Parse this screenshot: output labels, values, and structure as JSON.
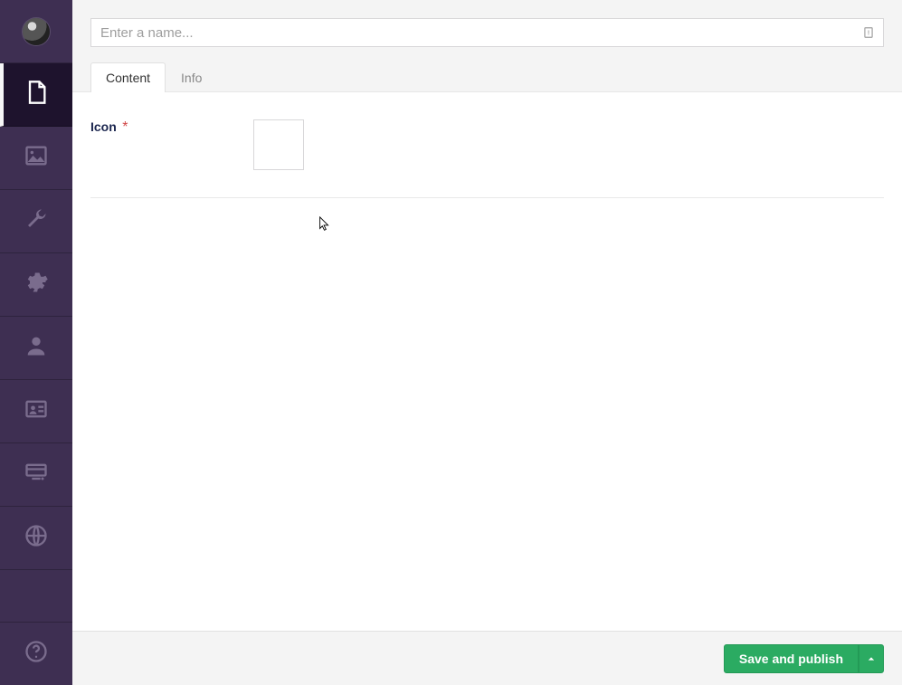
{
  "header": {
    "name_value": "",
    "name_placeholder": "Enter a name..."
  },
  "tabs": {
    "content": "Content",
    "info": "Info"
  },
  "fields": {
    "icon": {
      "label": "Icon",
      "required_marker": "*"
    }
  },
  "footer": {
    "save_publish_label": "Save and publish"
  },
  "sidebar": {
    "items": [
      {
        "name": "avatar"
      },
      {
        "name": "content",
        "active": true
      },
      {
        "name": "media"
      },
      {
        "name": "settings-wrench"
      },
      {
        "name": "settings-gear"
      },
      {
        "name": "users"
      },
      {
        "name": "members"
      },
      {
        "name": "forms"
      },
      {
        "name": "translation"
      }
    ],
    "help": {
      "name": "help"
    }
  }
}
